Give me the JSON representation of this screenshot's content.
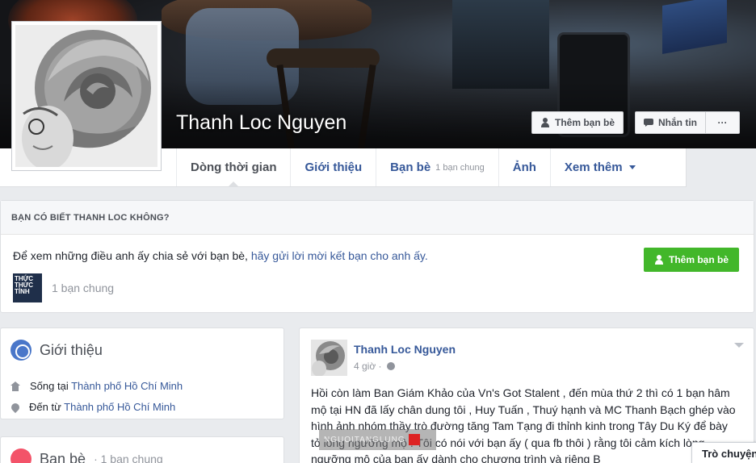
{
  "profile": {
    "name": "Thanh Loc Nguyen"
  },
  "actions": {
    "add_friend": "Thêm bạn bè",
    "message": "Nhắn tin",
    "more": "···"
  },
  "tabs": [
    {
      "label": "Dòng thời gian",
      "active": true
    },
    {
      "label": "Giới thiệu"
    },
    {
      "label": "Bạn bè",
      "sub": "1 bạn chung"
    },
    {
      "label": "Ảnh"
    },
    {
      "label": "Xem thêm"
    }
  ],
  "know_card": {
    "title": "BẠN CÓ BIẾT THANH LOC KHÔNG?",
    "text": "Để xem những điều anh ấy chia sẻ với bạn bè, ",
    "link": "hãy gửi lời mời kết bạn cho anh ấy.",
    "button": "Thêm bạn bè",
    "mutual": "1 bạn chung",
    "mutual_thumb": "THỨC THỨC TỈNH"
  },
  "intro": {
    "title": "Giới thiệu",
    "lives_label": "Sống tại",
    "lives_value": "Thành phố Hồ Chí Minh",
    "from_label": "Đến từ",
    "from_value": "Thành phố Hồ Chí Minh"
  },
  "friends": {
    "title": "Bạn bè",
    "sub": "· 1 bạn chung"
  },
  "post": {
    "author": "Thanh Loc Nguyen",
    "time": "4 giờ ·",
    "body": "Hồi còn làm Ban Giám Khảo của Vn's Got Stalent , đến mùa thứ 2 thì có 1 bạn hâm mộ tại HN đã lấy chân dung tôi , Huy Tuấn , Thuý hạnh và MC Thanh Bạch ghép vào hình ảnh nhóm thầy trò đường tăng Tam Tạng đi thỉnh kinh trong Tây Du Ký để bày tỏ lòng ngưỡng mộ . Tôi có nói với bạn ấy ( qua fb thôi ) rằng tôi cảm kích lòng ngưỡng mộ của bạn ấy dành cho chương trình và riêng B"
  },
  "watermark": "NGUOITANGLUNG",
  "chat": "Trò chuyện"
}
